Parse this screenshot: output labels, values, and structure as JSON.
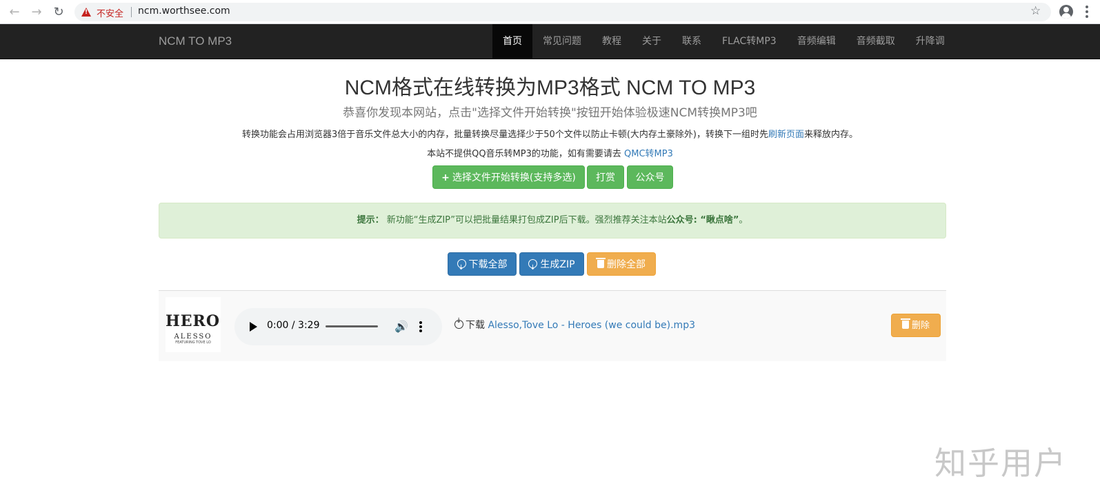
{
  "browser": {
    "insecure_label": "不安全",
    "url": "ncm.worthsee.com"
  },
  "navbar": {
    "brand": "NCM TO MP3",
    "items": [
      {
        "label": "首页",
        "active": true
      },
      {
        "label": "常见问题"
      },
      {
        "label": "教程"
      },
      {
        "label": "关于"
      },
      {
        "label": "联系"
      },
      {
        "label": "FLAC转MP3"
      },
      {
        "label": "音频编辑"
      },
      {
        "label": "音频截取"
      },
      {
        "label": "升降调"
      }
    ]
  },
  "main": {
    "title": "NCM格式在线转换为MP3格式 NCM TO MP3",
    "subtitle": "恭喜你发现本网站，点击\"选择文件开始转换\"按钮开始体验极速NCM转换MP3吧",
    "note1_text": "转换功能会占用浏览器3倍于音乐文件总大小的内存，批量转换尽量选择少于50个文件以防止卡顿(大内存土豪除外)，转换下一组时先",
    "note1_link": "刷新页面",
    "note1_suffix": "来释放内存。",
    "note2_text": "本站不提供QQ音乐转MP3的功能，如有需要请去 ",
    "note2_link": "QMC转MP3",
    "buttons": {
      "select": "选择文件开始转换(支持多选)",
      "reward": "打赏",
      "official": "公众号"
    },
    "alert": {
      "label": "提示：",
      "text": " 新功能“生成ZIP”可以把批量结果打包成ZIP后下载。强烈推荐关注本站",
      "bold": "公众号: “瞅点啥”",
      "end": "。"
    },
    "actions": {
      "download_all": "下载全部",
      "gen_zip": "生成ZIP",
      "delete_all": "删除全部"
    }
  },
  "file": {
    "cover_title": "HEROES",
    "cover_artist": "ALESSO",
    "cover_feat": "FEATURING TOVE LO",
    "time": "0:00 / 3:29",
    "download_label": "下载",
    "filename": "Alesso,Tove Lo - Heroes (we could be).mp3",
    "delete_label": "删除"
  },
  "watermark": "知乎用户"
}
